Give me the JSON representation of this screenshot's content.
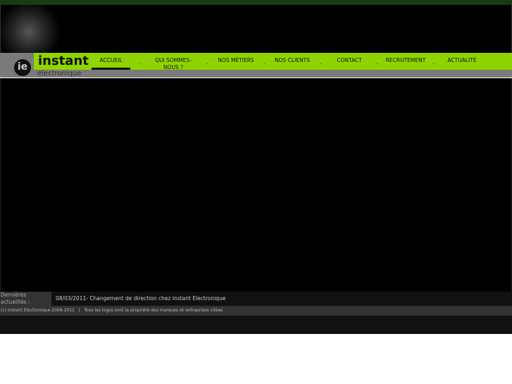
{
  "brand": {
    "logo_mark": "ie",
    "name": "instant",
    "sub": "électronique"
  },
  "nav": [
    {
      "label": "ACCUEIL",
      "active": true
    },
    {
      "label": "QUI SOMMES-NOUS ?"
    },
    {
      "label": "NOS MÉTIERS"
    },
    {
      "label": "NOS CLIENTS"
    },
    {
      "label": "CONTACT"
    },
    {
      "label": "RECRUTEMENT"
    },
    {
      "label": "ACTUALITÉ"
    }
  ],
  "news": {
    "label": "Dernières actualités :",
    "item": "08/03/2011- Changement de direction chez Instant Electronique"
  },
  "footer": {
    "text": "(c) Instant Electronique 2009-2011   |   Tous les logos sont la propriété des marques et entreprises citées"
  },
  "colors": {
    "accent": "#8fd400",
    "gray": "#7a7a7a"
  }
}
